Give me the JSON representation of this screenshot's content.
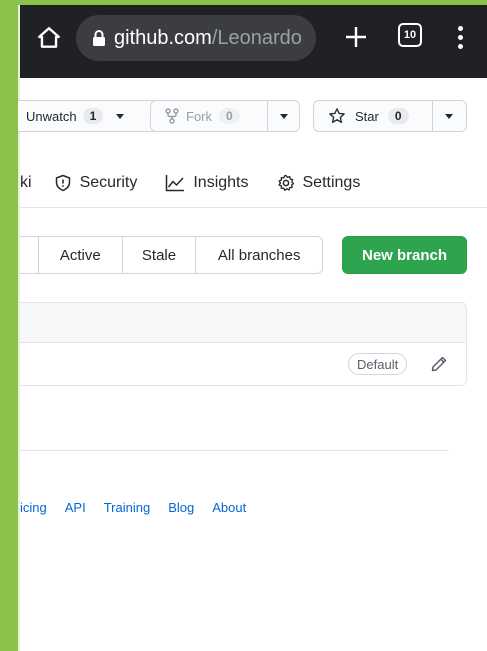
{
  "browser": {
    "url_domain": "github.com",
    "url_path": "/Leonardo",
    "tab_count": "10",
    "icons": [
      "home-icon",
      "lock-icon",
      "plus-icon",
      "tabs-icon",
      "menu-icon"
    ]
  },
  "repo_actions": {
    "watch_label": "Unwatch",
    "watch_count": "1",
    "fork_label": "Fork",
    "fork_count": "0",
    "star_label": "Star",
    "star_count": "0"
  },
  "nav": {
    "wiki_label": "ki",
    "security_label": "Security",
    "insights_label": "Insights",
    "settings_label": "Settings"
  },
  "branches": {
    "filters": [
      "Active",
      "Stale",
      "All branches"
    ],
    "new_branch_label": "New branch",
    "default_badge": "Default"
  },
  "footer": {
    "links": [
      "icing",
      "API",
      "Training",
      "Blog",
      "About"
    ]
  },
  "colors": {
    "accent_green": "#2ea44f",
    "link_blue": "#0366d6",
    "browser_bar": "#202124",
    "frame_green": "#8bc34a"
  }
}
